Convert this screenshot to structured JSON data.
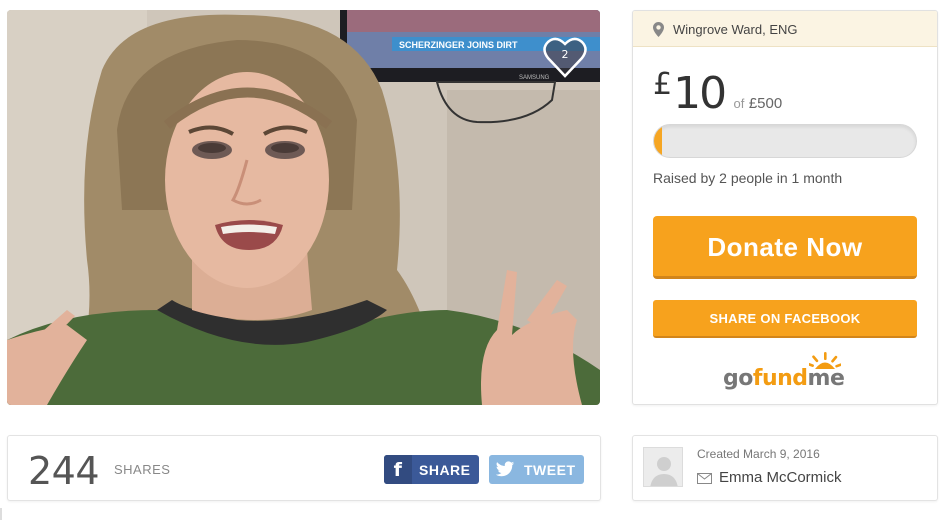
{
  "photo": {
    "heart_count": "2",
    "tv_ticker": "SCHERZINGER JOINS DIRT",
    "tv_brand": "SAMSUNG"
  },
  "shares": {
    "count": "244",
    "label": "SHARES",
    "facebook_button": "SHARE",
    "twitter_button": "TWEET"
  },
  "campaign": {
    "location": "Wingrove Ward, ENG",
    "currency": "£",
    "raised_amount": "10",
    "goal_prefix": "of",
    "goal_amount": "£500",
    "progress_fraction": 0.02,
    "raised_by_text": "Raised by 2 people in 1 month",
    "donate_button": "Donate Now",
    "share_facebook_button": "SHARE ON FACEBOOK",
    "logo": {
      "go": "go",
      "fund": "fund",
      "me": "me"
    }
  },
  "organizer": {
    "created_text": "Created March 9, 2016",
    "name": "Emma McCormick"
  },
  "colors": {
    "accent_orange": "#f7a21d",
    "facebook_blue": "#3b5998",
    "twitter_blue": "#8ab7e0",
    "location_bar": "#fbf4e3"
  },
  "icons": [
    "location-pin-icon",
    "heart-icon",
    "facebook-icon",
    "twitter-icon",
    "mail-icon",
    "avatar-placeholder-icon",
    "gofundme-sun-icon"
  ]
}
